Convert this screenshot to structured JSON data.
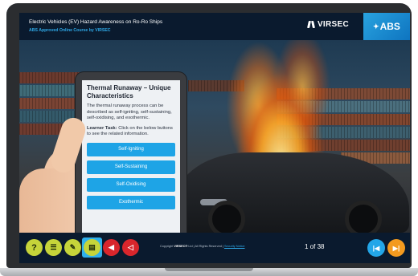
{
  "header": {
    "course_title": "Electric Vehicles (EV) Hazard Awareness on Ro-Ro Ships",
    "course_subtitle": "ABS Approved Online Course by VIRSEC",
    "virsec_logo_text": "VIRSEC",
    "abs_logo_text": "ABS"
  },
  "card": {
    "title": "Thermal Runaway – Unique Characteristics",
    "body": "The thermal runaway process can be described as self-igniting, self-sustaining, self-oxidising, and exothermic.",
    "task_label": "Learner Task:",
    "task_text": "Click on the below buttons to see the related information.",
    "buttons": [
      "Self-Igniting",
      "Self-Sustaining",
      "Self-Oxidising",
      "Exothermic"
    ]
  },
  "footer": {
    "copyright_prefix": "Copyright",
    "copyright_brand": "VIRSEC®",
    "copyright_suffix": "Ltd | All Rights Reserved |",
    "security_notice": "Security Notice",
    "page_indicator": "1 of 38",
    "tools": {
      "help": "help-icon",
      "menu": "menu-list-icon",
      "pen": "pencil-icon",
      "doc": "document-icon",
      "vol1": "volume-icon",
      "vol2": "mute-icon"
    }
  },
  "colors": {
    "accent_blue": "#1ea4e6",
    "tool_green": "#c6d43a",
    "tool_red": "#d8262c",
    "nav_orange": "#f39a1f",
    "header_bg": "#0a1a2e"
  }
}
